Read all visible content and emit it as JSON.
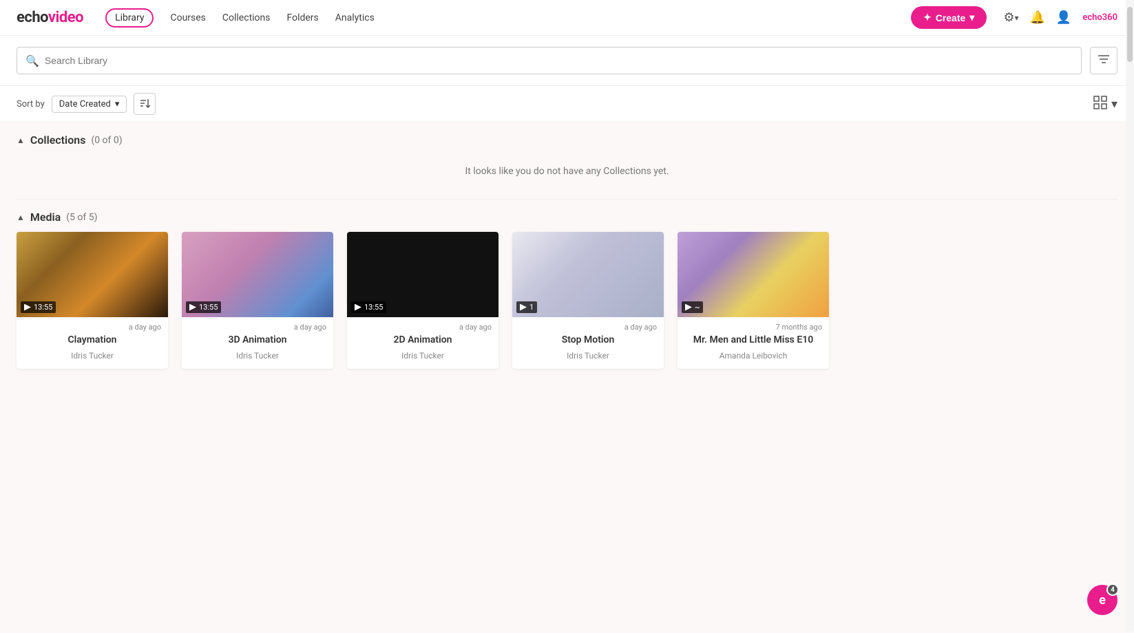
{
  "app": {
    "logo_echo": "echo",
    "logo_video": "video",
    "brand_color": "#e91e8c"
  },
  "nav": {
    "links": [
      {
        "id": "library",
        "label": "Library",
        "active": true
      },
      {
        "id": "courses",
        "label": "Courses",
        "active": false
      },
      {
        "id": "collections",
        "label": "Collections",
        "active": false
      },
      {
        "id": "folders",
        "label": "Folders",
        "active": false
      },
      {
        "id": "analytics",
        "label": "Analytics",
        "active": false
      }
    ],
    "create_label": "Create",
    "create_icon": "✦",
    "settings_icon": "⚙",
    "bell_icon": "🔔",
    "user_icon": "👤",
    "brand_label": "echo360"
  },
  "search": {
    "placeholder": "Search Library",
    "filter_icon": "≡"
  },
  "toolbar": {
    "sort_label": "Sort by",
    "sort_value": "Date Created",
    "sort_dropdown_icon": "▾",
    "sort_direction_icon": "↕",
    "view_grid_icon": "⊞",
    "view_dropdown_icon": "▾"
  },
  "collections_section": {
    "title": "Collections",
    "count": "(0 of 0)",
    "empty_message": "It looks like you do not have any Collections yet."
  },
  "media_section": {
    "title": "Media",
    "count": "(5 of 5)",
    "items": [
      {
        "id": "claymation",
        "title": "Claymation",
        "author": "Idris Tucker",
        "date": "a day ago",
        "duration": "13:55",
        "thumb_class": "thumb-claymation"
      },
      {
        "id": "3d-animation",
        "title": "3D Animation",
        "author": "Idris Tucker",
        "date": "a day ago",
        "duration": "13:55",
        "thumb_class": "thumb-3d"
      },
      {
        "id": "2d-animation",
        "title": "2D Animation",
        "author": "Idris Tucker",
        "date": "a day ago",
        "duration": "13:55",
        "thumb_class": "thumb-2d"
      },
      {
        "id": "stop-motion",
        "title": "Stop Motion",
        "author": "Idris Tucker",
        "date": "a day ago",
        "duration": "1",
        "thumb_class": "thumb-stopmotion"
      },
      {
        "id": "mr-men",
        "title": "Mr. Men and Little Miss E10",
        "author": "Amanda Leibovich",
        "date": "7 months ago",
        "duration": "~",
        "thumb_class": "thumb-mrmen"
      }
    ]
  },
  "chat": {
    "icon": "e",
    "badge": "4"
  }
}
